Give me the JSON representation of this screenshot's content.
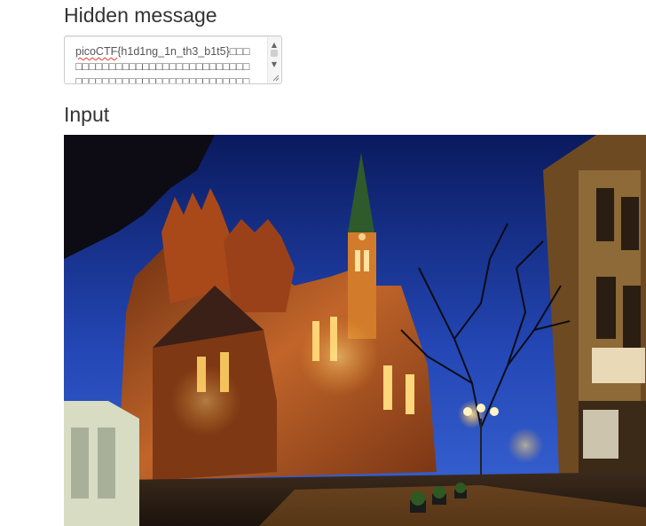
{
  "hidden_message": {
    "title": "Hidden message",
    "text_prefix": "picoCTF",
    "text_rest": "{h1d1ng_1n_th3_b1t5}□□□□□□□□□□□□□□□□□□□□□□□□□□□□□□□□□□□□□□□□□□□□□□□□□□□□□□□□□□□□□□□□□□□□□□□□□□□□□□□□□□□□"
  },
  "input": {
    "title": "Input",
    "image_description": "night-church-street-photo"
  },
  "colors": {
    "text": "#333333",
    "border": "#cccccc",
    "sky_top": "#0b1f6e",
    "sky_bottom": "#2d57c8",
    "brick": "#b45a21"
  }
}
